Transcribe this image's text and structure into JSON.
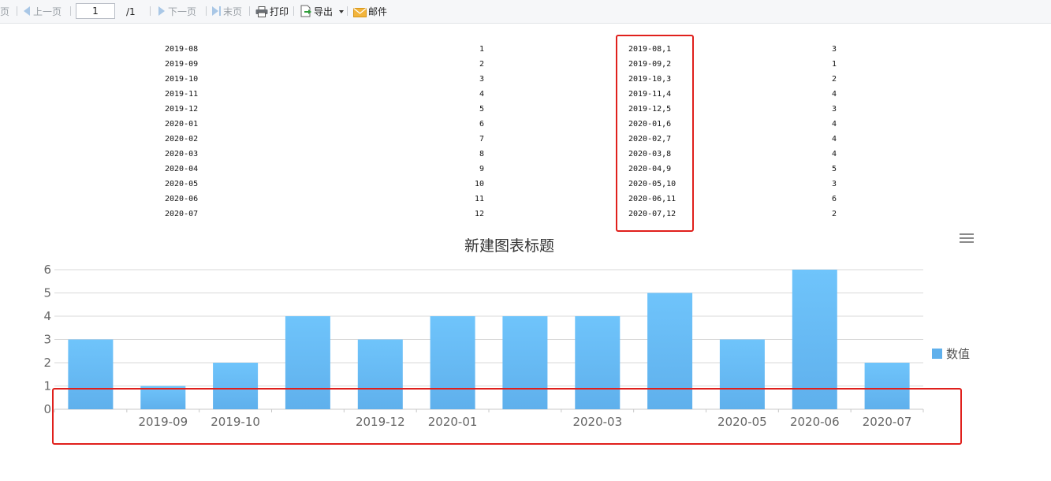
{
  "toolbar": {
    "first_page": "页",
    "prev_page": "上一页",
    "page_current": "1",
    "page_total": "/1",
    "next_page": "下一页",
    "last_page": "末页",
    "print": "打印",
    "export": "导出",
    "email": "邮件"
  },
  "table": {
    "rows": [
      [
        "2019-08",
        "1",
        "2019-08,1",
        "3"
      ],
      [
        "2019-09",
        "2",
        "2019-09,2",
        "1"
      ],
      [
        "2019-10",
        "3",
        "2019-10,3",
        "2"
      ],
      [
        "2019-11",
        "4",
        "2019-11,4",
        "4"
      ],
      [
        "2019-12",
        "5",
        "2019-12,5",
        "3"
      ],
      [
        "2020-01",
        "6",
        "2020-01,6",
        "4"
      ],
      [
        "2020-02",
        "7",
        "2020-02,7",
        "4"
      ],
      [
        "2020-03",
        "8",
        "2020-03,8",
        "4"
      ],
      [
        "2020-04",
        "9",
        "2020-04,9",
        "5"
      ],
      [
        "2020-05",
        "10",
        "2020-05,10",
        "3"
      ],
      [
        "2020-06",
        "11",
        "2020-06,11",
        "6"
      ],
      [
        "2020-07",
        "12",
        "2020-07,12",
        "2"
      ]
    ]
  },
  "colors": {
    "bar_top": "#6fc4fb",
    "bar_bottom": "#5fb0ec",
    "highlight": "#e0201c",
    "legend": "#5fb0ec"
  },
  "chart_data": {
    "type": "bar",
    "title": "新建图表标题",
    "categories": [
      "",
      "2019-09",
      "2019-10",
      "",
      "2019-12",
      "2020-01",
      "",
      "2020-03",
      "",
      "2020-05",
      "2020-06",
      "2020-07"
    ],
    "series": [
      {
        "name": "数值",
        "values": [
          3,
          1,
          2,
          4,
          3,
          4,
          4,
          4,
          5,
          3,
          6,
          2
        ]
      }
    ],
    "yticks": [
      "0",
      "1",
      "2",
      "3",
      "4",
      "5",
      "6"
    ],
    "ylim": [
      0,
      6
    ],
    "grid": true,
    "legend_position": "right"
  }
}
